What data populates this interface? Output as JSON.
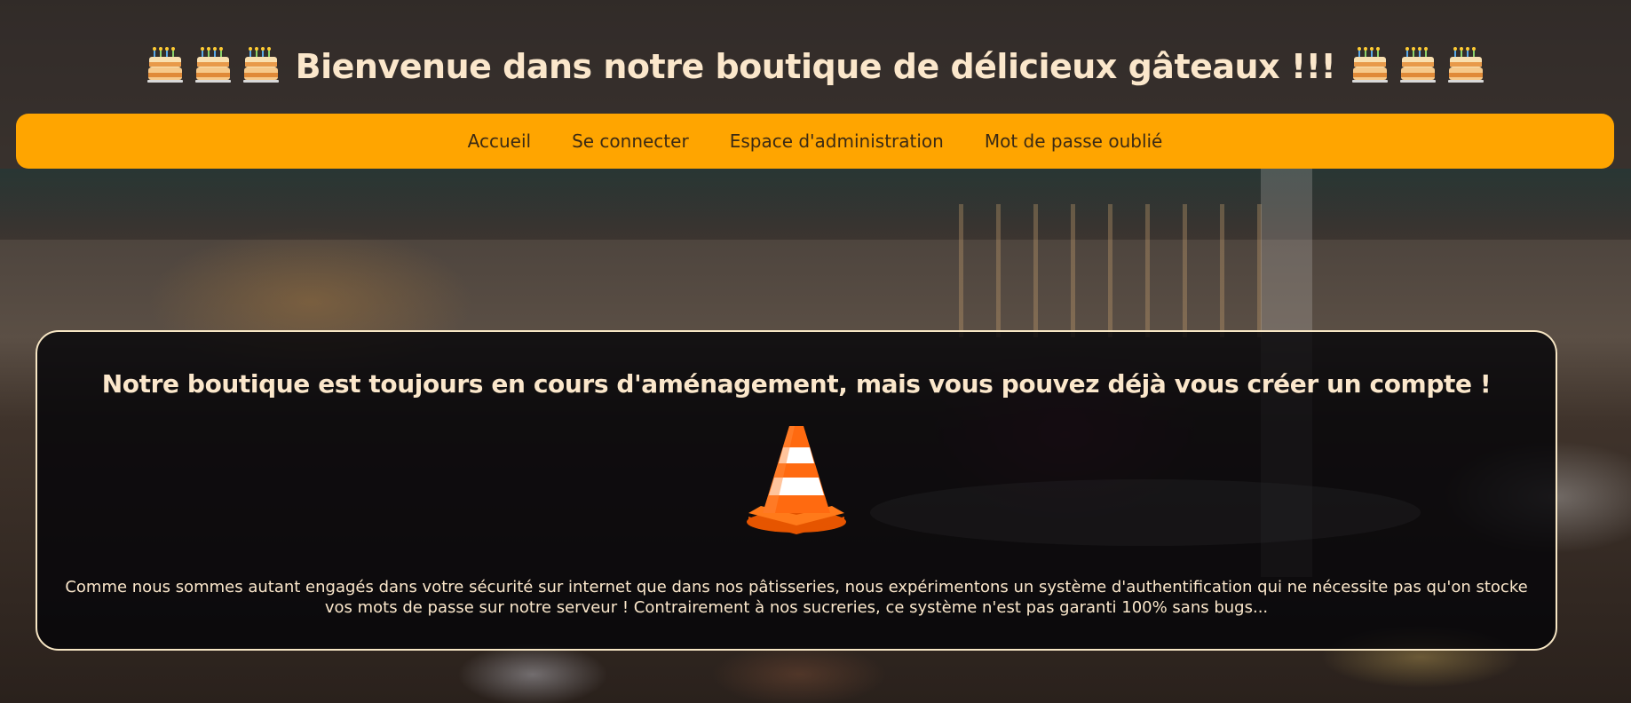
{
  "header": {
    "title": "Bienvenue dans notre boutique de délicieux gâteaux !!!",
    "icons": [
      "cake-icon",
      "cake-icon",
      "cake-icon",
      "cake-icon",
      "cake-icon",
      "cake-icon"
    ]
  },
  "nav": {
    "items": [
      {
        "label": "Accueil"
      },
      {
        "label": "Se connecter"
      },
      {
        "label": "Espace d'administration"
      },
      {
        "label": "Mot de passe oublié"
      }
    ]
  },
  "colors": {
    "accent": "#ffa500",
    "text": "#fbe7cb",
    "panel_border": "#f7e6c4",
    "cone": "#ff6a10"
  },
  "notice": {
    "heading": "Notre boutique est toujours en cours d'aménagement, mais vous pouvez déjà vous créer un compte !",
    "icon": "traffic-cone-icon",
    "body": "Comme nous sommes autant engagés dans votre sécurité sur internet que dans nos pâtisseries, nous expérimentons un système d'authentification qui ne nécessite pas qu'on stocke vos mots de passe sur notre serveur ! Contrairement à nos sucreries, ce système n'est pas garanti 100% sans bugs..."
  }
}
